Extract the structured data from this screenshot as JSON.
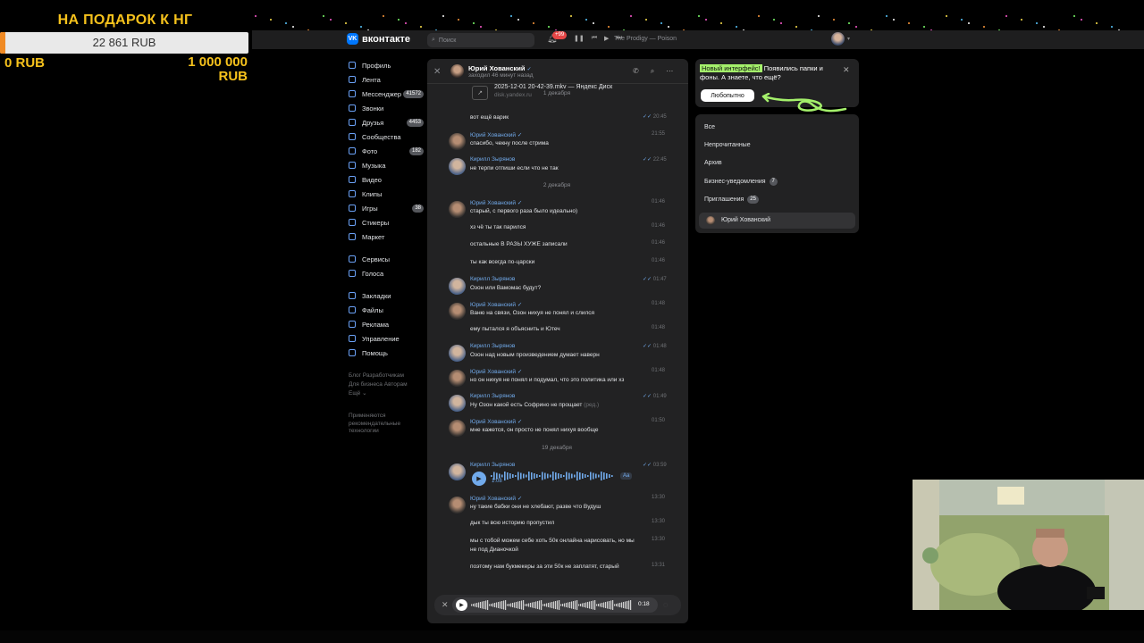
{
  "donation": {
    "title": "НА ПОДАРОК К НГ",
    "amount": "22 861 RUB",
    "min_label": "0 RUB",
    "max_label": "1 000 000 RUB",
    "progress_fraction": 0.0229,
    "colors": {
      "title": "#f6c21c",
      "fill": "#f08a24",
      "bar": "#e9e9e9"
    }
  },
  "header": {
    "logo_text": "вконтакте",
    "search_placeholder": "Поиск",
    "notifications_badge": "+99",
    "track": "The Prodigy — Poison",
    "accent": "#0077ff"
  },
  "nav": {
    "items": [
      {
        "label": "Профиль",
        "icon": "profile-icon"
      },
      {
        "label": "Лента",
        "icon": "feed-icon"
      },
      {
        "label": "Мессенджер",
        "icon": "messenger-icon",
        "badge": "41572"
      },
      {
        "label": "Звонки",
        "icon": "phone-icon"
      },
      {
        "label": "Друзья",
        "icon": "friends-icon",
        "badge": "4453"
      },
      {
        "label": "Сообщества",
        "icon": "communities-icon"
      },
      {
        "label": "Фото",
        "icon": "photo-icon",
        "badge": "182"
      },
      {
        "label": "Музыка",
        "icon": "music-icon"
      },
      {
        "label": "Видео",
        "icon": "video-icon"
      },
      {
        "label": "Клипы",
        "icon": "clips-icon"
      },
      {
        "label": "Игры",
        "icon": "games-icon",
        "badge": "38"
      },
      {
        "label": "Стикеры",
        "icon": "stickers-icon"
      },
      {
        "label": "Маркет",
        "icon": "market-icon"
      }
    ],
    "items2": [
      {
        "label": "Сервисы",
        "icon": "services-icon"
      },
      {
        "label": "Голоса",
        "icon": "votes-icon"
      }
    ],
    "items3": [
      {
        "label": "Закладки",
        "icon": "bookmarks-icon"
      },
      {
        "label": "Файлы",
        "icon": "files-icon"
      },
      {
        "label": "Реклама",
        "icon": "ads-icon"
      },
      {
        "label": "Управление",
        "icon": "manage-icon"
      },
      {
        "label": "Помощь",
        "icon": "help-icon"
      }
    ],
    "footer_links": [
      "Блог",
      "Разработчикам",
      "Для бизнеса",
      "Авторам",
      "Ещё"
    ],
    "footer_note": "Применяются рекомендательные технологии"
  },
  "chat": {
    "name": "Юрий Хованский",
    "status": "заходил 46 минут назад",
    "file": {
      "title": "2025-12-01 20-42-39.mkv — Яндекс Диск",
      "domain": "disk.yandex.ru",
      "date_overlay": "1 декабря"
    },
    "messages": [
      {
        "author": "",
        "text": "вот ещё варик",
        "time": "20:45",
        "read": true
      },
      {
        "author": "Юрий Хованский",
        "avatar": "y",
        "text": "спасибо, чекну после стрима",
        "time": "21:55"
      },
      {
        "author": "Кирилл Зырянов",
        "avatar": "k",
        "text": "не терпи отпиши если что не так",
        "time": "22:45",
        "read": true
      },
      {
        "date": "2 декабря"
      },
      {
        "author": "Юрий Хованский",
        "avatar": "y",
        "text": "старый, с первого раза было идеально)",
        "time": "01:46"
      },
      {
        "author": "",
        "text": "хз чё ты так парился",
        "time": "01:46"
      },
      {
        "author": "",
        "text": "остальные В РАЗЫ ХУЖЕ записали",
        "time": "01:46"
      },
      {
        "author": "",
        "text": "ты как всегда по-царски",
        "time": "01:46"
      },
      {
        "author": "Кирилл Зырянов",
        "avatar": "k",
        "text": "Озон или Вамомас будут?",
        "time": "01:47",
        "read": true
      },
      {
        "author": "Юрий Хованский",
        "avatar": "y",
        "text": "Ваню на связи, Озон нихуя не понял и слился",
        "time": "01:48"
      },
      {
        "author": "",
        "text": "ему пытался я объяснить и Ютеч",
        "time": "01:48"
      },
      {
        "author": "Кирилл Зырянов",
        "avatar": "k",
        "text": "Озон над новым произведением думает наверн",
        "time": "01:48",
        "read": true
      },
      {
        "author": "Юрий Хованский",
        "avatar": "y",
        "text": "но он нихуя не понял и подумал, что это политика или хз",
        "time": "01:48"
      },
      {
        "author": "Кирилл Зырянов",
        "avatar": "k",
        "text": "Ну Озон какой есть Софрино не прощает",
        "edited": "(ред.)",
        "time": "01:49",
        "read": true
      },
      {
        "author": "Юрий Хованский",
        "avatar": "y",
        "text": "мне кажется, он просто не понял нихуя вообще",
        "time": "01:50"
      },
      {
        "date": "19 декабря"
      },
      {
        "author": "Кирилл Зырянов",
        "avatar": "k",
        "voice": true,
        "duration": "1:08",
        "aa": "Aa",
        "time": "03:59",
        "read": true
      },
      {
        "author": "Юрий Хованский",
        "avatar": "y",
        "text": "ну такие бабки они не хлебают, разве что Вудуш",
        "time": "13:30"
      },
      {
        "author": "",
        "text": "дык ты всю историю пропустил",
        "time": "13:30"
      },
      {
        "author": "",
        "text": "мы с тобой можем себе хоть 50к онлайна нарисовать, но мы",
        "text2": "не под Дианочкой",
        "time": "13:30"
      },
      {
        "author": "",
        "text": "поэтому нам букмекеры за эти 50к не заплатят, старый",
        "time": "13:31"
      }
    ],
    "recorder_time": "0:18"
  },
  "promo": {
    "highlight": "Новый интерфейс!",
    "text": " Появились папки и фоны. А знаете, что ещё?",
    "button": "Любопытно",
    "highlight_color": "#a4f06b"
  },
  "filters": {
    "items": [
      {
        "label": "Все"
      },
      {
        "label": "Непрочитанные"
      },
      {
        "label": "Архив"
      },
      {
        "label": "Бизнес-уведомления",
        "badge": "7"
      },
      {
        "label": "Приглашения",
        "badge": "25"
      }
    ],
    "active_chat": "Юрий Хованский"
  }
}
